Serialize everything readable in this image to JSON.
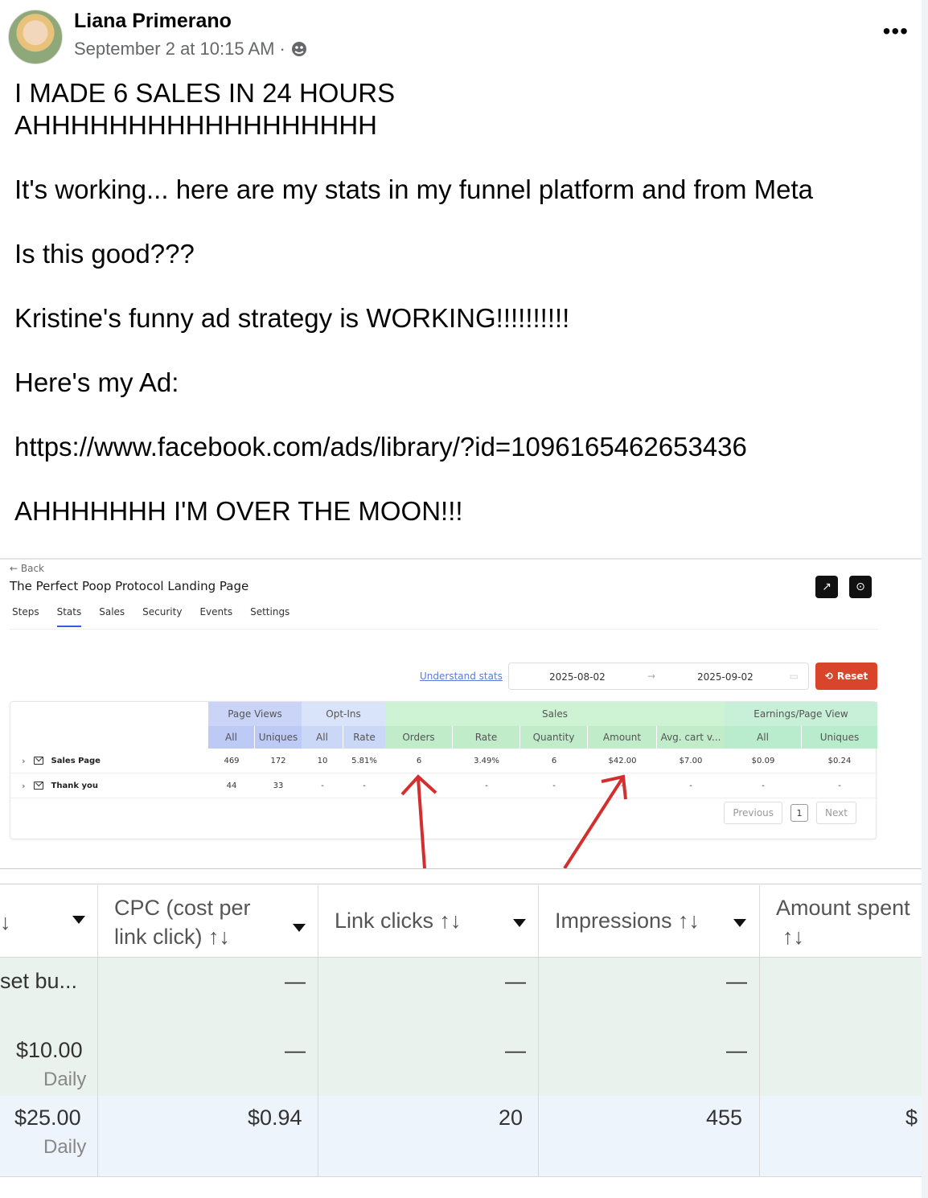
{
  "post": {
    "author": "Liana Primerano",
    "timestamp": "September 2 at 10:15 AM",
    "separator": "·",
    "audience_icon": "globe-icon",
    "more_icon": "•••",
    "lines": [
      "I MADE 6 SALES IN 24 HOURS",
      "AHHHHHHHHHHHHHHHHHH",
      "",
      "It's working... here are my stats in my funnel platform and from Meta",
      "",
      "Is this good???",
      "",
      "Kristine's funny ad strategy is WORKING!!!!!!!!!!",
      "",
      "Here's my Ad:",
      "",
      "https://www.facebook.com/ads/library/?id=1096165462653436",
      "",
      "AHHHHHHH I'M OVER THE MOON!!!"
    ]
  },
  "funnel": {
    "back_label": "← Back",
    "title": "The Perfect Poop Protocol Landing Page",
    "top_buttons": [
      "↗",
      "⊙"
    ],
    "tabs": [
      "Steps",
      "Stats",
      "Sales",
      "Security",
      "Events",
      "Settings"
    ],
    "active_tab": "Stats",
    "understand_link": "Understand stats",
    "date_from": "2025-08-02",
    "date_arrow": "→",
    "date_to": "2025-09-02",
    "reset_label": "Reset",
    "groups": [
      "Page Views",
      "Opt-Ins",
      "Sales",
      "Earnings/Page View"
    ],
    "subheaders": [
      "All",
      "Uniques",
      "All",
      "Rate",
      "Orders",
      "Rate",
      "Quantity",
      "Amount",
      "Avg. cart v...",
      "All",
      "Uniques"
    ],
    "rows": [
      {
        "label": "Sales Page",
        "values": [
          "469",
          "172",
          "10",
          "5.81%",
          "6",
          "3.49%",
          "6",
          "$42.00",
          "$7.00",
          "$0.09",
          "$0.24"
        ]
      },
      {
        "label": "Thank you",
        "values": [
          "44",
          "33",
          "-",
          "-",
          "-",
          "-",
          "-",
          "-",
          "-",
          "-",
          "-"
        ]
      }
    ],
    "pager": {
      "previous": "Previous",
      "page": "1",
      "next": "Next"
    },
    "accent_colors": {
      "reset": "#d9452b",
      "arrows": "#d32f2f",
      "active_tab": "#3b5bdb"
    }
  },
  "meta_ads": {
    "headers": {
      "col0_sort": "↓",
      "cpc_line1": "CPC (cost per",
      "cpc_line2": "link click) ↑↓",
      "link_clicks": "Link clicks ↑↓",
      "impressions": "Impressions ↑↓",
      "amount_line1": "Amount spent",
      "amount_line2": "↑↓"
    },
    "row1": {
      "col0_line1": "set bu...",
      "col0_line2": "$10.00",
      "col0_line3": "Daily",
      "cpc_a": "—",
      "link_a": "—",
      "impr_a": "—",
      "cpc_b": "—",
      "link_b": "—",
      "impr_b": "—"
    },
    "row2": {
      "budget": "$25.00",
      "budget_sub": "Daily",
      "cpc": "$0.94",
      "link_clicks": "20",
      "impressions": "455",
      "amount": "$"
    }
  }
}
